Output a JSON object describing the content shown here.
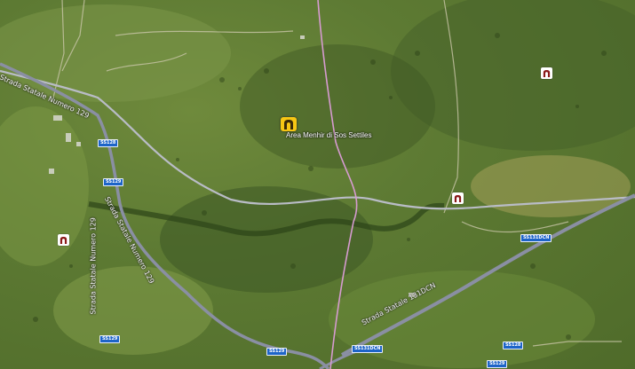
{
  "map": {
    "poi_main_label": "Area Menhir di Sos Settiles",
    "road_labels": {
      "ss129_topleft": "Strada Statale Numero 129",
      "ss129_mid": "Strada Statale Numero 129",
      "ss131_diag": "Strada Statale 131DCN",
      "ss129_left": "Strada Statale Numero 129"
    },
    "shields": {
      "s1": "SS128",
      "s2": "SS129",
      "s3": "SS129",
      "s4": "SS131DCN",
      "s5": "SS128",
      "s6": "SS131DCN",
      "s7": "SS129",
      "s8": "SS129"
    },
    "colors": {
      "main_road": "#9aa0b4",
      "pink_line": "#d69bd0",
      "poi_main": "#f6c614",
      "poi_icon": "#8b1a1a"
    }
  }
}
